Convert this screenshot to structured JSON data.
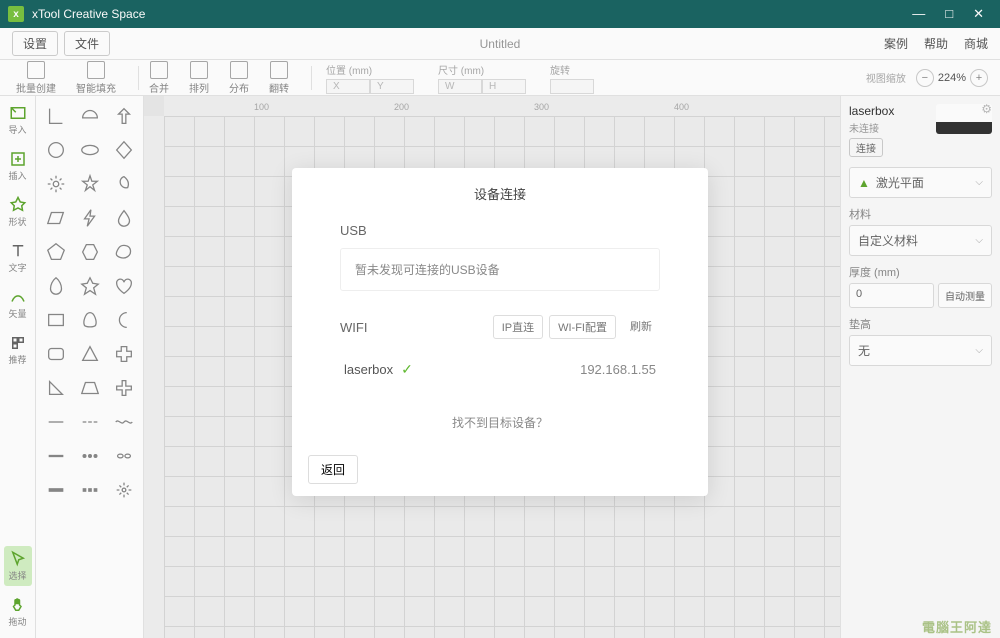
{
  "titlebar": {
    "app_name": "xTool Creative Space"
  },
  "menubar": {
    "settings": "设置",
    "file": "文件",
    "doc_title": "Untitled",
    "examples": "案例",
    "help": "帮助",
    "store": "商城"
  },
  "toolbar": {
    "groups": [
      "批量创建",
      "智能填充",
      "合并",
      "排列",
      "分布",
      "翻转"
    ],
    "position_label": "位置 (mm)",
    "size_label": "尺寸 (mm)",
    "rotate_label": "旋转",
    "zoom_label": "视图缩放",
    "x_ph": "X",
    "y_ph": "Y",
    "w_ph": "W",
    "h_ph": "H",
    "zoom_value": "224%"
  },
  "leftbar": {
    "items": [
      "导入",
      "插入",
      "形状",
      "文字",
      "矢量",
      "推荐"
    ],
    "select": "选择",
    "pan": "拖动"
  },
  "ruler_marks": [
    "100",
    "200",
    "300",
    "400"
  ],
  "rightpanel": {
    "device_name": "laserbox",
    "device_status": "未连接",
    "connect_btn": "连接",
    "mode_label": "激光平面",
    "material_label": "材料",
    "material_value": "自定义材料",
    "thickness_label": "厚度 (mm)",
    "thickness_value": "0",
    "auto_measure": "自动测量",
    "offset_label": "垫高",
    "offset_value": "无"
  },
  "modal": {
    "title": "设备连接",
    "usb_label": "USB",
    "usb_empty": "暂未发现可连接的USB设备",
    "wifi_label": "WIFI",
    "ip_direct": "IP直连",
    "wifi_config": "WI-FI配置",
    "refresh": "刷新",
    "wifi_device": "laserbox",
    "wifi_ip": "192.168.1.55",
    "not_found": "找不到目标设备？",
    "back": "返回"
  },
  "watermark": "電腦王阿達"
}
